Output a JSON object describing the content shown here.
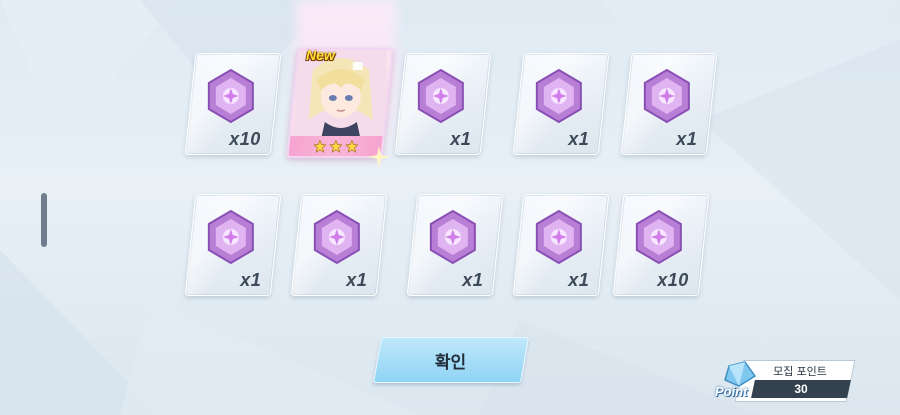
{
  "rewards": [
    {
      "type": "gem",
      "quantity": "x10"
    },
    {
      "type": "character",
      "badge": "New",
      "stars": 3
    },
    {
      "type": "gem",
      "quantity": "x1"
    },
    {
      "type": "gem",
      "quantity": "x1"
    },
    {
      "type": "gem",
      "quantity": "x1"
    },
    {
      "type": "gem",
      "quantity": "x1"
    },
    {
      "type": "gem",
      "quantity": "x1"
    },
    {
      "type": "gem",
      "quantity": "x1"
    },
    {
      "type": "gem",
      "quantity": "x1"
    },
    {
      "type": "gem",
      "quantity": "x10"
    }
  ],
  "confirm_label": "확인",
  "point": {
    "word": "Point",
    "label": "모집 포인트",
    "value": "30"
  },
  "colors": {
    "gem": "#c98ee0",
    "confirm": "#9dd9f6",
    "star": "#ffd84a"
  }
}
